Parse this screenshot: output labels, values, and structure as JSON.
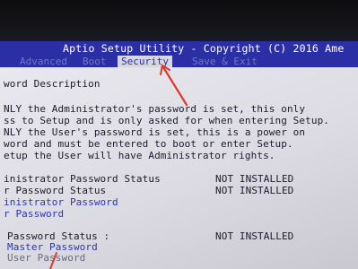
{
  "title_bar": {
    "text": "Aptio Setup Utility - Copyright (C) 2016 Ame"
  },
  "tabs": [
    {
      "label": "Advanced",
      "active": false
    },
    {
      "label": "Boot",
      "active": false
    },
    {
      "label": "Security",
      "active": true
    },
    {
      "label": "Save & Exit",
      "active": false
    }
  ],
  "section_title": "word Description",
  "description": [
    "NLY the Administrator's password is set, this only",
    "ss to Setup and is only asked for when entering Setup.",
    "NLY the User's password is set, this is a power on",
    "word and must be entered to boot or enter Setup.",
    "etup the User will have Administrator rights."
  ],
  "status_rows": [
    {
      "label": "inistrator Password Status",
      "value": "NOT INSTALLED"
    },
    {
      "label": "r Password Status",
      "value": "NOT INSTALLED"
    }
  ],
  "links": {
    "admin_password": "inistrator Password",
    "user_password": "r Password"
  },
  "hdd": {
    "status_label": "Password Status  :",
    "status_value": "NOT INSTALLED",
    "master_password": "Master Password",
    "user_password": "User Password"
  },
  "colors": {
    "title_bar_bg": "#2b2fa6",
    "content_bg": "#e1e0e7",
    "selected_text": "#2b35b8",
    "annotation_arrow": "#e0372c"
  }
}
